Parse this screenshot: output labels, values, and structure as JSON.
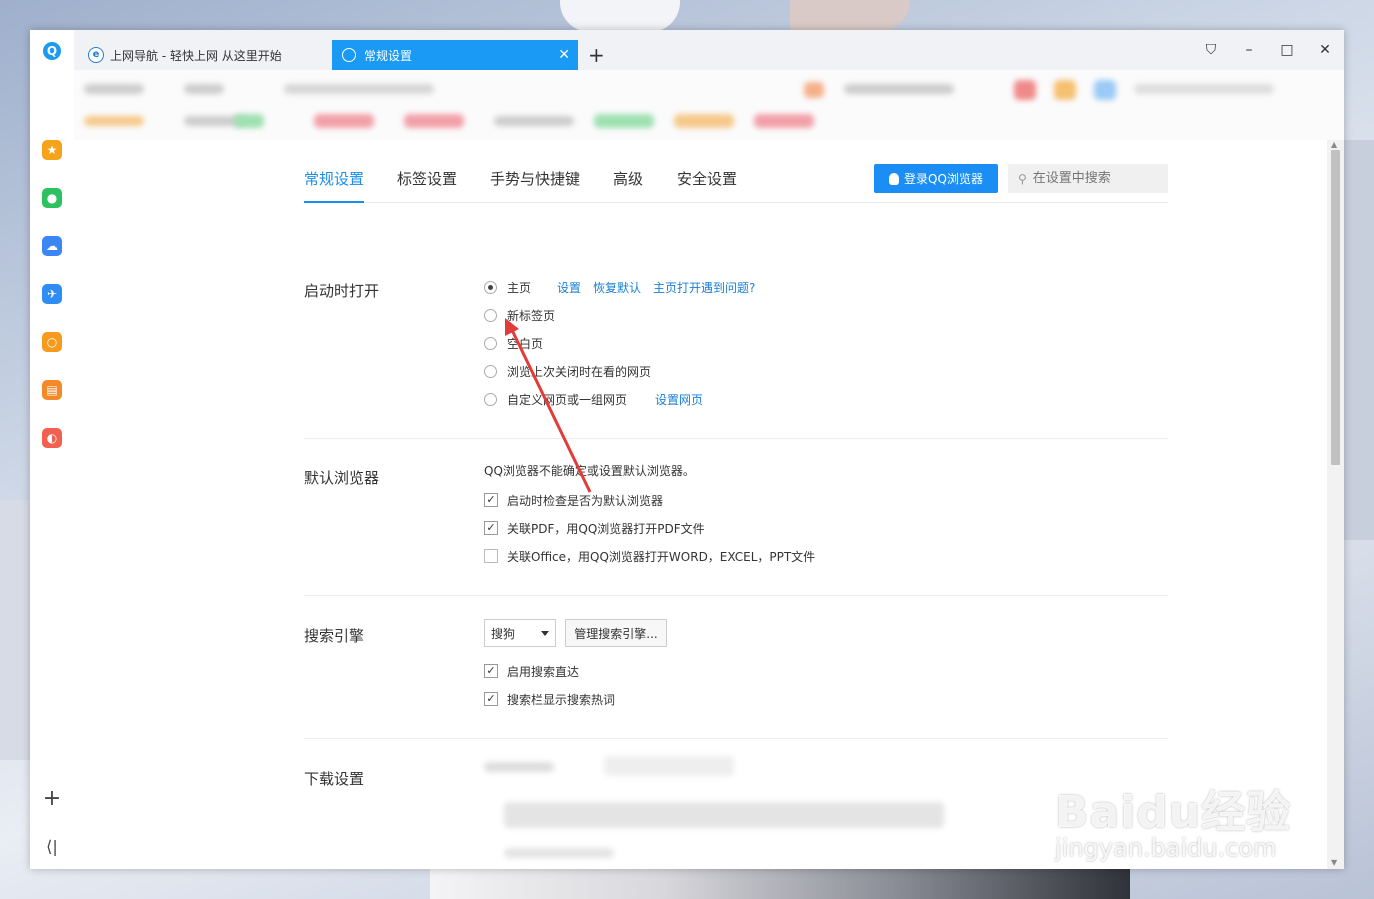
{
  "tabs": [
    {
      "label": "上网导航 - 轻快上网 从这里开始",
      "icon": "ie-icon"
    },
    {
      "label": "常规设置",
      "icon": "gear-icon",
      "active": true
    }
  ],
  "window_controls": [
    "skin-icon",
    "minimize-icon",
    "maximize-icon",
    "close-icon"
  ],
  "sidebar": {
    "icons": [
      {
        "name": "favorites-icon",
        "color": "#f7a21b"
      },
      {
        "name": "wechat-icon",
        "color": "#2dc160"
      },
      {
        "name": "cloud-icon",
        "color": "#3b86f5"
      },
      {
        "name": "translate-icon",
        "color": "#2f8cf3"
      },
      {
        "name": "search-icon",
        "color": "#f79a1e"
      },
      {
        "name": "reader-icon",
        "color": "#f5892a"
      },
      {
        "name": "photo-icon",
        "color": "#f2614f"
      }
    ]
  },
  "nav": {
    "tabs": [
      "常规设置",
      "标签设置",
      "手势与快捷键",
      "高级",
      "安全设置"
    ],
    "active": "常规设置",
    "login_label": "登录QQ浏览器",
    "search_placeholder": "在设置中搜索"
  },
  "startup": {
    "title": "启动时打开",
    "options": [
      {
        "label": "主页",
        "selected": true
      },
      {
        "label": "新标签页",
        "selected": false
      },
      {
        "label": "空白页",
        "selected": false
      },
      {
        "label": "浏览上次关闭时在看的网页",
        "selected": false
      },
      {
        "label": "自定义网页或一组网页",
        "selected": false
      }
    ],
    "home_links": [
      "设置",
      "恢复默认",
      "主页打开遇到问题?"
    ],
    "custom_link": "设置网页"
  },
  "default_browser": {
    "title": "默认浏览器",
    "note": "QQ浏览器不能确定或设置默认浏览器。",
    "checks": [
      {
        "label": "启动时检查是否为默认浏览器",
        "checked": true
      },
      {
        "label": "关联PDF，用QQ浏览器打开PDF文件",
        "checked": true
      },
      {
        "label": "关联Office，用QQ浏览器打开WORD，EXCEL，PPT文件",
        "checked": false
      }
    ]
  },
  "search_engine": {
    "title": "搜索引擎",
    "selected": "搜狗",
    "manage_label": "管理搜索引擎...",
    "checks": [
      {
        "label": "启用搜索直达",
        "checked": true
      },
      {
        "label": "搜索栏显示搜索热词",
        "checked": true
      }
    ]
  },
  "download": {
    "title": "下载设置"
  },
  "watermark": {
    "main": "Baidu经验",
    "sub": "jingyan.baidu.com"
  },
  "accent_color": "#1a8ef5",
  "annotation_color": "#e23b3b"
}
